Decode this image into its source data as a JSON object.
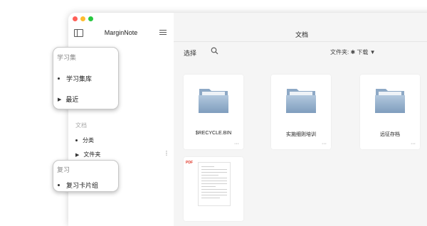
{
  "window": {
    "controls": [
      "close",
      "minimize",
      "zoom"
    ]
  },
  "sidebar": {
    "app_title": "MarginNote",
    "toggle_icon": "sidebar-toggle-icon",
    "menu_icon": "hamburger-menu-icon",
    "documents_section": {
      "title": "文档",
      "items": [
        {
          "label": "分类",
          "marker": "bullet"
        },
        {
          "label": "文件夹",
          "marker": "disclosure-triangle",
          "more_icon": "vertical-ellipsis-icon"
        }
      ]
    }
  },
  "callouts": {
    "study": {
      "title": "学习集",
      "items": [
        {
          "label": "学习集库",
          "marker": "bullet"
        },
        {
          "label": "最近",
          "marker": "disclosure-triangle"
        }
      ]
    },
    "review": {
      "title": "复习",
      "items": [
        {
          "label": "复习卡片组",
          "marker": "bullet"
        }
      ]
    }
  },
  "main": {
    "title": "文档",
    "toolbar": {
      "select_label": "选择",
      "search_icon": "search-icon",
      "folder_selector": "文件夹: ✱ 下载 ▼"
    },
    "items": [
      {
        "name": "$RECYCLE.BIN",
        "type": "folder",
        "more": "···"
      },
      {
        "name": "实施细则培训",
        "type": "folder",
        "more": "···"
      },
      {
        "name": "远征存档",
        "type": "folder",
        "more": "···"
      },
      {
        "name": "",
        "type": "pdf",
        "badge": "PDF"
      }
    ]
  },
  "colors": {
    "folder_top": "#a9c0d8",
    "folder_bottom": "#7f9dbd",
    "pdf_badge": "#e0392b",
    "content_bg": "#f5f5f5"
  }
}
